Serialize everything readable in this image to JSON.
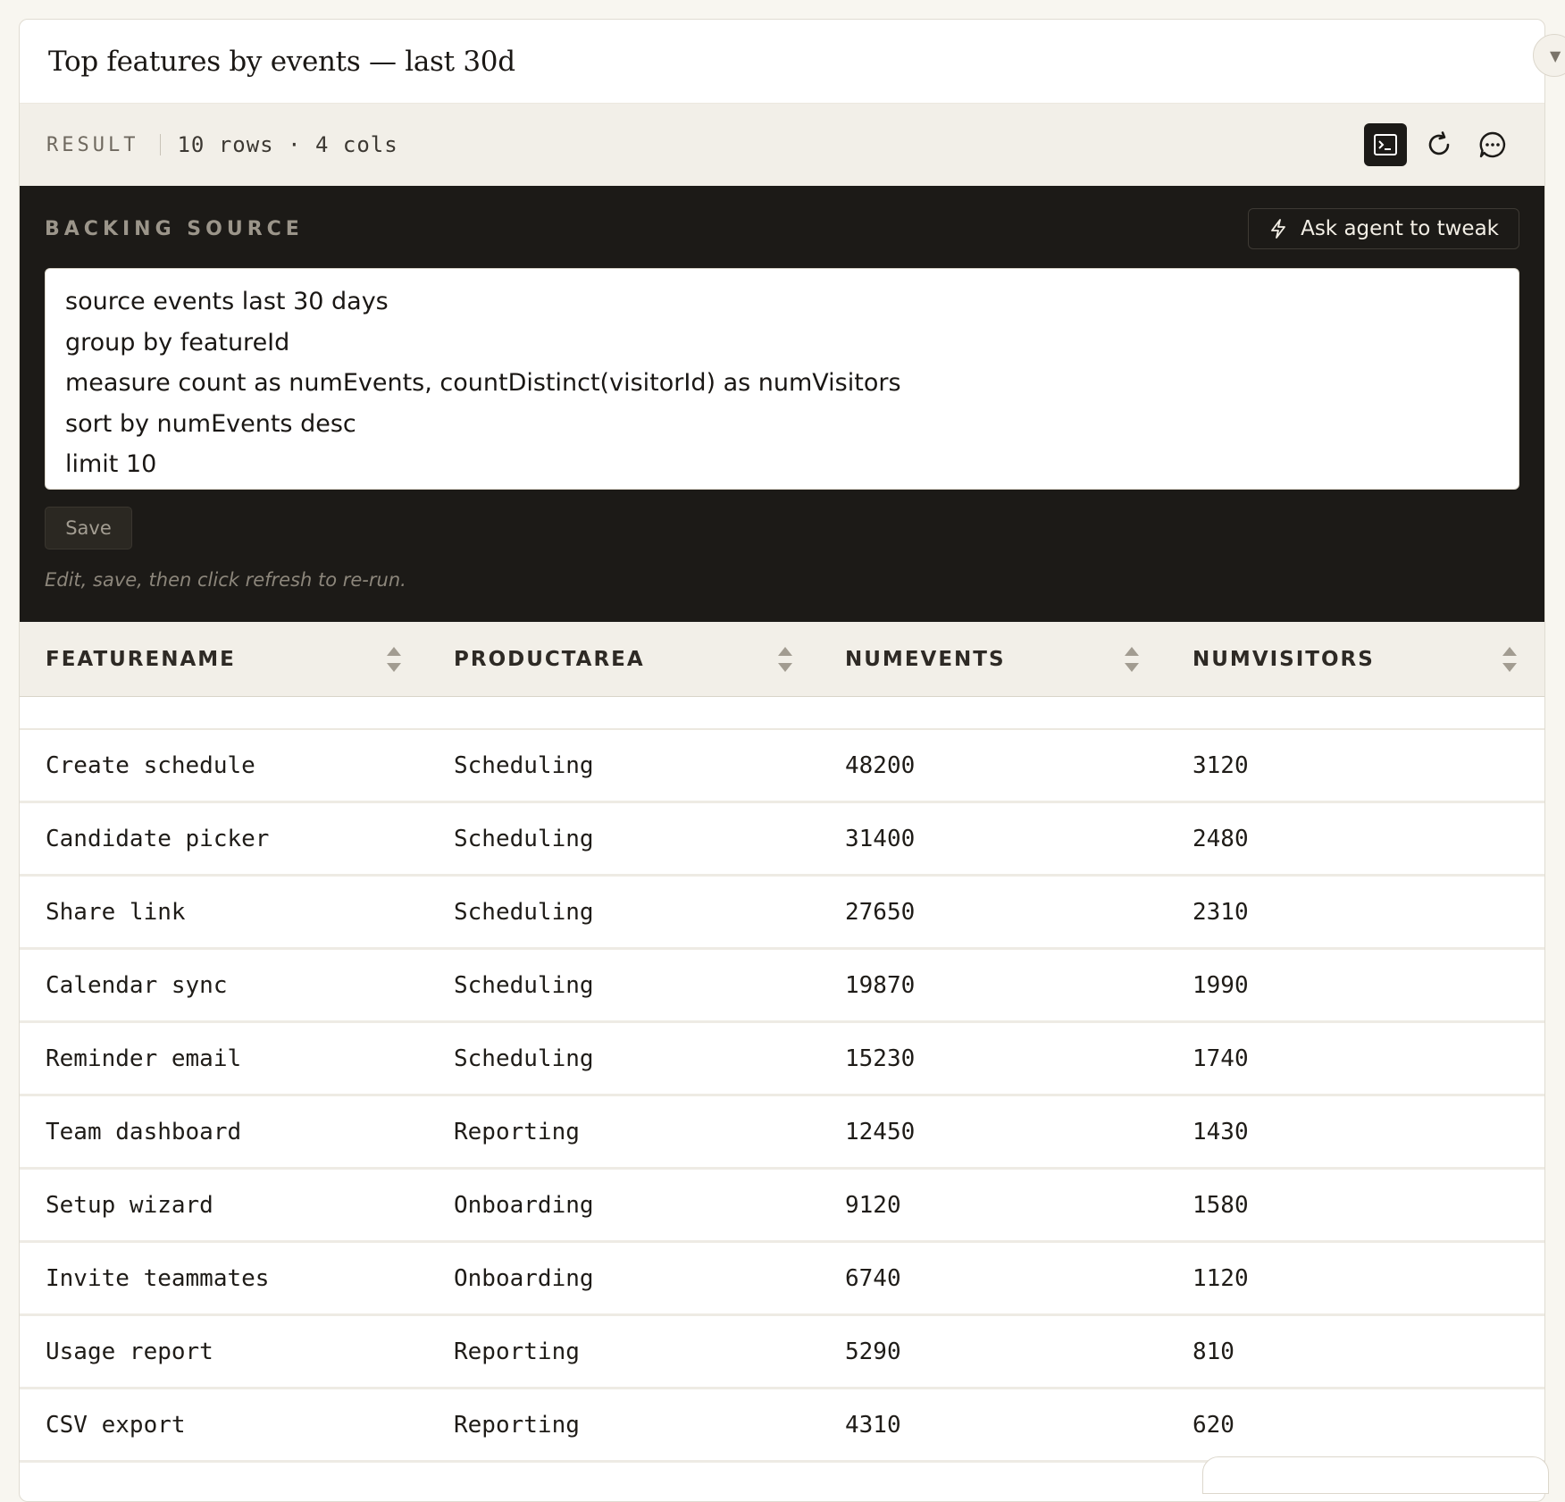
{
  "title": "Top features by events — last 30d",
  "result": {
    "label": "RESULT",
    "meta": "10 rows · 4 cols"
  },
  "backing": {
    "label": "BACKING SOURCE",
    "ask_button": "Ask agent to tweak",
    "code_lines": [
      "source events last 30 days",
      "group by featureId",
      "measure count as numEvents, countDistinct(visitorId) as numVisitors",
      "sort by numEvents desc",
      "limit 10"
    ],
    "save_label": "Save",
    "hint": "Edit, save, then click refresh to re-run."
  },
  "table": {
    "columns": [
      "FEATURENAME",
      "PRODUCTAREA",
      "NUMEVENTS",
      "NUMVISITORS"
    ],
    "rows": [
      [
        "Create schedule",
        "Scheduling",
        "48200",
        "3120"
      ],
      [
        "Candidate picker",
        "Scheduling",
        "31400",
        "2480"
      ],
      [
        "Share link",
        "Scheduling",
        "27650",
        "2310"
      ],
      [
        "Calendar sync",
        "Scheduling",
        "19870",
        "1990"
      ],
      [
        "Reminder email",
        "Scheduling",
        "15230",
        "1740"
      ],
      [
        "Team dashboard",
        "Reporting",
        "12450",
        "1430"
      ],
      [
        "Setup wizard",
        "Onboarding",
        "9120",
        "1580"
      ],
      [
        "Invite teammates",
        "Onboarding",
        "6740",
        "1120"
      ],
      [
        "Usage report",
        "Reporting",
        "5290",
        "810"
      ],
      [
        "CSV export",
        "Reporting",
        "4310",
        "620"
      ]
    ]
  },
  "icons": {
    "terminal": "terminal-icon",
    "refresh": "refresh-icon",
    "comment": "comment-icon",
    "lightning": "lightning-icon",
    "sort": "sort-icon",
    "collapse": "chevron-down-icon"
  },
  "colors": {
    "background": "#f8f6f0",
    "header_bg": "#f2efe8",
    "dark_panel": "#1c1a17",
    "accent_active": "#1c1a17"
  }
}
